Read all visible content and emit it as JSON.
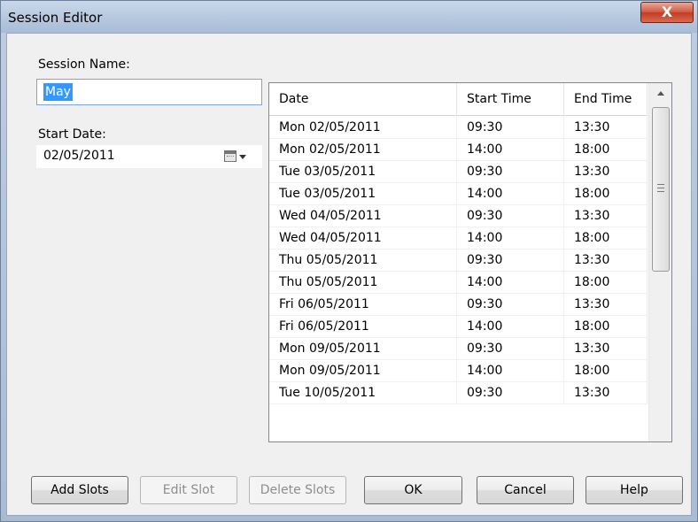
{
  "window": {
    "title": "Session Editor",
    "close_label": "X"
  },
  "form": {
    "session_name_label": "Session Name:",
    "session_name_value": "May",
    "start_date_label": "Start Date:",
    "start_date_value": "02/05/2011",
    "calendar_icon": "calendar-icon"
  },
  "table": {
    "columns": [
      "Date",
      "Start Time",
      "End Time"
    ],
    "rows": [
      [
        "Mon 02/05/2011",
        "09:30",
        "13:30"
      ],
      [
        "Mon 02/05/2011",
        "14:00",
        "18:00"
      ],
      [
        "Tue 03/05/2011",
        "09:30",
        "13:30"
      ],
      [
        "Tue 03/05/2011",
        "14:00",
        "18:00"
      ],
      [
        "Wed 04/05/2011",
        "09:30",
        "13:30"
      ],
      [
        "Wed 04/05/2011",
        "14:00",
        "18:00"
      ],
      [
        "Thu 05/05/2011",
        "09:30",
        "13:30"
      ],
      [
        "Thu 05/05/2011",
        "14:00",
        "18:00"
      ],
      [
        "Fri 06/05/2011",
        "09:30",
        "13:30"
      ],
      [
        "Fri 06/05/2011",
        "14:00",
        "18:00"
      ],
      [
        "Mon 09/05/2011",
        "09:30",
        "13:30"
      ],
      [
        "Mon 09/05/2011",
        "14:00",
        "18:00"
      ],
      [
        "Tue 10/05/2011",
        "09:30",
        "13:30"
      ]
    ]
  },
  "buttons": {
    "add_slots": "Add Slots",
    "edit_slot": "Edit Slot",
    "delete_slots": "Delete Slots",
    "ok": "OK",
    "cancel": "Cancel",
    "help": "Help"
  },
  "colors": {
    "selection": "#3399ff",
    "close_button": "#c23c23"
  }
}
